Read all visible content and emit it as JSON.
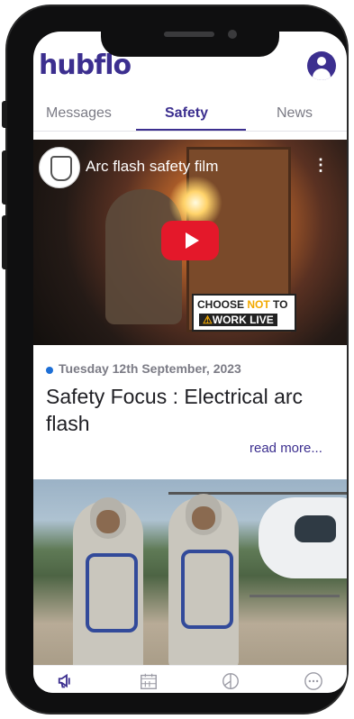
{
  "app": {
    "logo_text": "hubflo"
  },
  "header": {
    "profile_icon": "user-circle-icon"
  },
  "tabs": [
    {
      "label": "Messages",
      "active": false
    },
    {
      "label": "Safety",
      "active": true
    },
    {
      "label": "News",
      "active": false
    }
  ],
  "video": {
    "title": "Arc flash safety film",
    "play_icon": "youtube-play-icon",
    "menu_icon": "kebab-menu-icon",
    "badge_line1_pre": "CHOOSE ",
    "badge_line1_not": "NOT",
    "badge_line1_post": " TO",
    "badge_line2": "WORK LIVE",
    "badge_warn": "⚠"
  },
  "article": {
    "date": "Tuesday 12th September, 2023",
    "title": "Safety Focus : Electrical arc flash",
    "read_more": "read more..."
  },
  "bottom_nav": [
    {
      "icon": "megaphone-icon",
      "active": true
    },
    {
      "icon": "calendar-icon",
      "active": false
    },
    {
      "icon": "pie-chart-icon",
      "active": false
    },
    {
      "icon": "more-icon",
      "active": false
    }
  ],
  "colors": {
    "brand": "#3c2f8f",
    "tab_inactive": "#7b7b85",
    "date_dot": "#1d6fd6",
    "youtube_red": "#e4182a"
  }
}
